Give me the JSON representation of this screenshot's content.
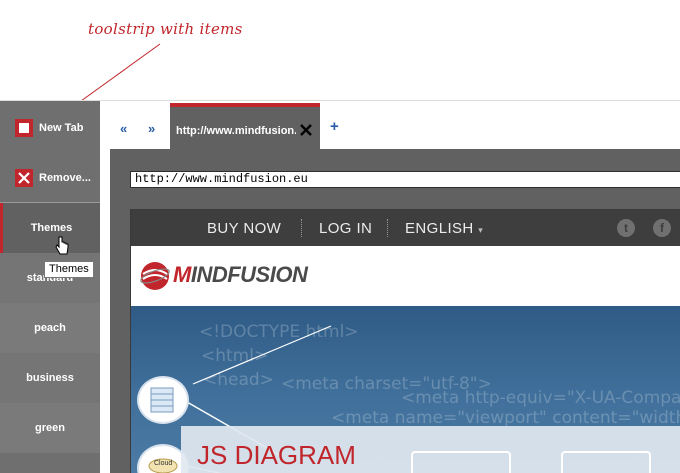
{
  "annotation": {
    "text": "toolstrip with items"
  },
  "toolstrip": {
    "new_tab_label": "New Tab",
    "remove_label": "Remove...",
    "themes_label": "Themes",
    "theme_items": [
      "standard",
      "peach",
      "business",
      "green"
    ],
    "tooltip": "Themes"
  },
  "tabs": {
    "back_symbol": "«",
    "forward_symbol": "»",
    "active_tab_title": "http://www.mindfusion...",
    "add_symbol": "+"
  },
  "browser": {
    "address": "http://www.mindfusion.eu"
  },
  "website": {
    "nav": {
      "buy_now": "BUY NOW",
      "log_in": "LOG IN",
      "language": "ENGLISH"
    },
    "social": {
      "twitter": "t",
      "facebook": "f"
    },
    "logo_prefix": "M",
    "logo_rest": "INDFUSION",
    "hero_code": [
      "<!DOCTYPE html>",
      "<html>",
      "<head>",
      "<meta charset=\"utf-8\">",
      "<meta http-equiv=\"X-UA-Compatible\" content=\"width",
      "<meta name=\"viewport\" content=\"width"
    ],
    "node_label": "Cloud",
    "hero_title": "JS DIAGRAM"
  },
  "colors": {
    "accent": "#c0262b",
    "toolstrip": "#6f6f6f",
    "link": "#2a5ea8"
  }
}
